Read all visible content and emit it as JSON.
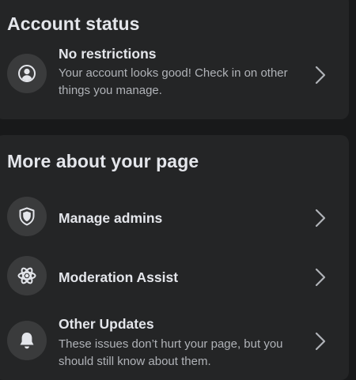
{
  "account_status": {
    "title": "Account status",
    "rows": [
      {
        "icon": "person-circle-icon",
        "title": "No restrictions",
        "description": "Your account looks good! Check in on other things you manage."
      }
    ]
  },
  "more_about_page": {
    "title": "More about your page",
    "rows": [
      {
        "icon": "shield-icon",
        "title": "Manage admins"
      },
      {
        "icon": "atom-icon",
        "title": "Moderation Assist"
      },
      {
        "icon": "bell-icon",
        "title": "Other Updates",
        "description": "These issues don’t hurt your page, but you should still know about them."
      }
    ]
  },
  "colors": {
    "background": "#18191a",
    "card": "#242526",
    "icon_circle": "#3a3b3c",
    "primary_text": "#e4e6eb",
    "secondary_text": "#b0b3b8"
  }
}
